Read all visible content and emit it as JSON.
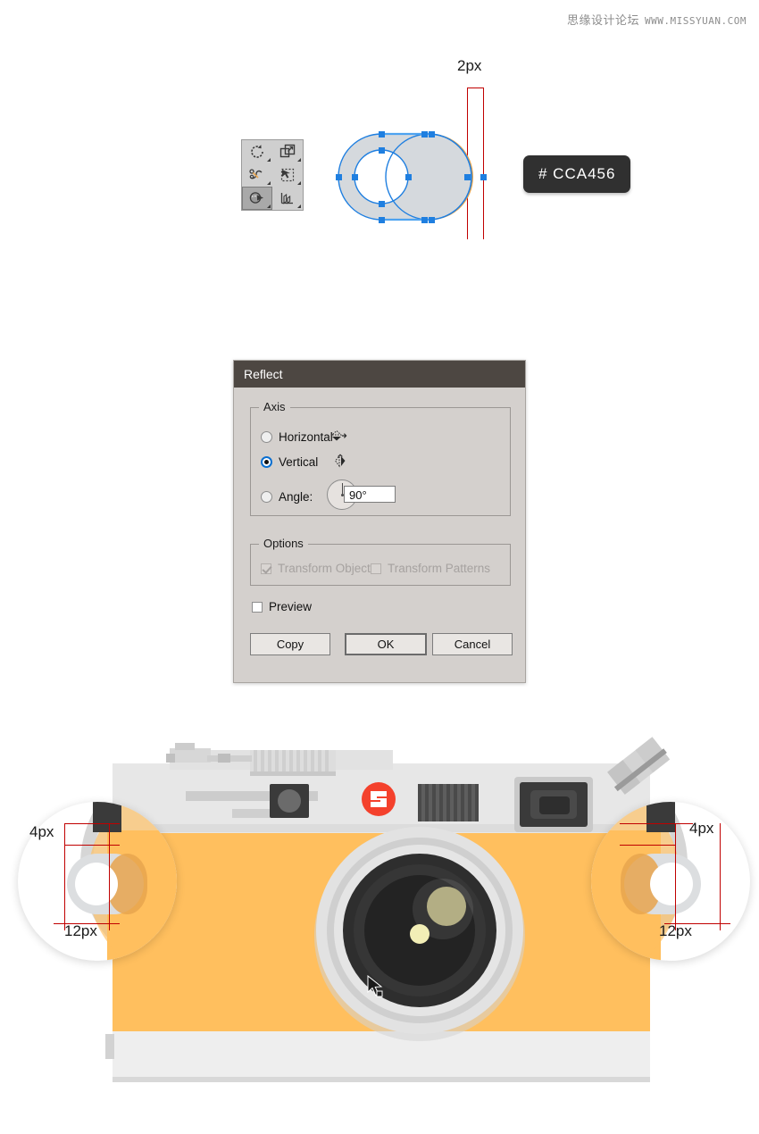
{
  "watermark": {
    "cn": "思缘设计论坛",
    "url": "WWW.MISSYUAN.COM"
  },
  "top_diagram": {
    "dimension_label": "2px",
    "color_chip": "# CCA456",
    "tools": [
      {
        "name": "rotate-tool",
        "selected": false
      },
      {
        "name": "scale-tool",
        "selected": false
      },
      {
        "name": "reshape-tool",
        "selected": false
      },
      {
        "name": "free-transform-tool",
        "selected": false
      },
      {
        "name": "blend-tool",
        "selected": true
      },
      {
        "name": "graph-tool",
        "selected": false
      }
    ]
  },
  "dialog": {
    "title": "Reflect",
    "axis": {
      "legend": "Axis",
      "options": [
        {
          "label": "Horizontal",
          "selected": false
        },
        {
          "label": "Vertical",
          "selected": true
        }
      ],
      "angle_label": "Angle:",
      "angle_value": "90°",
      "angle_selected": false
    },
    "options": {
      "legend": "Options",
      "transform_objects": {
        "label": "Transform Objects",
        "checked": true,
        "disabled": true
      },
      "transform_patterns": {
        "label": "Transform Patterns",
        "checked": false,
        "disabled": true
      }
    },
    "preview": {
      "label": "Preview",
      "checked": false
    },
    "buttons": {
      "copy": "Copy",
      "ok": "OK",
      "cancel": "Cancel"
    }
  },
  "camera": {
    "left_callout": {
      "top_label": "4px",
      "bottom_label": "12px"
    },
    "right_callout": {
      "top_label": "4px",
      "bottom_label": "12px"
    }
  },
  "colors": {
    "body_orange": "#FFBF5E",
    "body_orange_dark": "#EFAE4F",
    "crescent_orange": "#E8A44D",
    "selection_blue": "#1F7FE0",
    "shape_fill": "#D5D9DD",
    "guide_red": "#C00000",
    "titlebar": "#4D4742",
    "dialog_bg": "#D4D0CD",
    "chip_bg": "#303030",
    "logo_red": "#F4412C",
    "camera_light": "#E7E7E7",
    "camera_dark": "#3A3A3A"
  }
}
